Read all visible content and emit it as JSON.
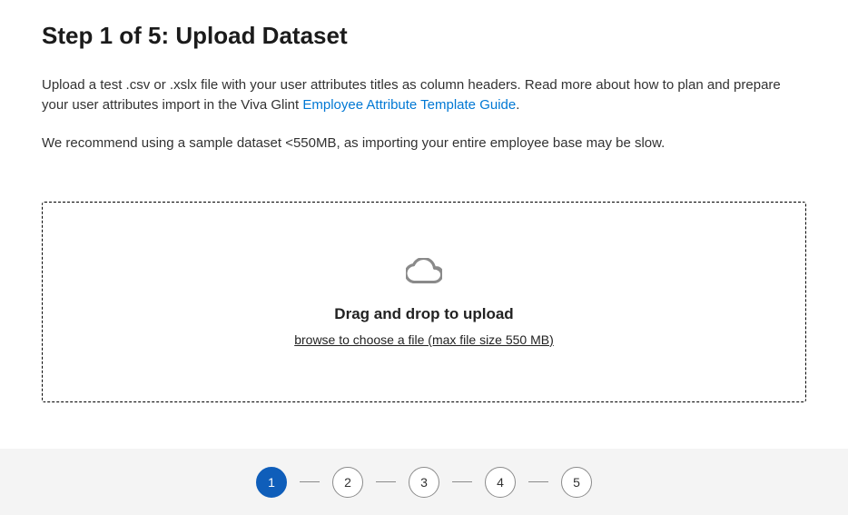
{
  "title": "Step 1 of 5: Upload Dataset",
  "description_part1": "Upload a test .csv or .xslx file with your user attributes titles as column headers. Read more about how to plan and prepare your user attributes import in the Viva Glint ",
  "description_link": "Employee Attribute Template Guide",
  "description_part2": ".",
  "recommendation": "We recommend using a sample dataset <550MB, as importing your entire employee base may be slow.",
  "dropzone": {
    "title": "Drag and drop to upload",
    "browse": "browse to choose a file (max file size 550 MB)"
  },
  "stepper": {
    "steps": [
      "1",
      "2",
      "3",
      "4",
      "5"
    ],
    "active": 0
  }
}
